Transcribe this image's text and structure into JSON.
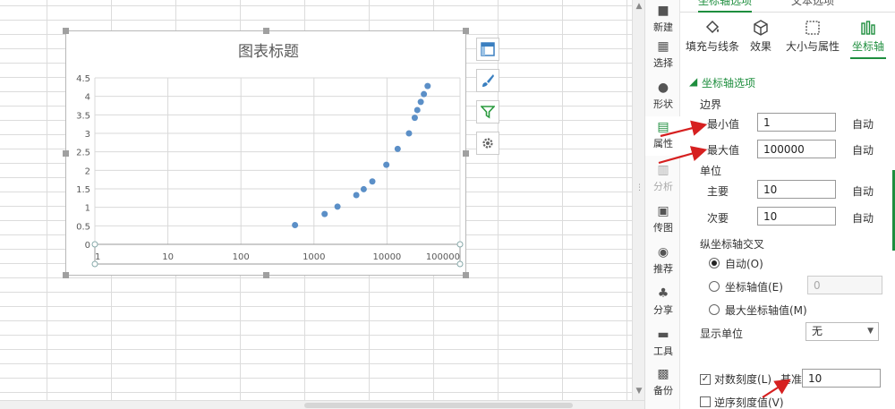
{
  "chart_data": {
    "type": "scatter",
    "title": "图表标题",
    "x_scale": "log",
    "xlim": [
      1,
      100000
    ],
    "ylim": [
      0,
      4.5
    ],
    "x_ticks": [
      "1",
      "10",
      "100",
      "1000",
      "10000",
      "100000"
    ],
    "y_ticks": [
      "0",
      "0.5",
      "1",
      "1.5",
      "2",
      "2.5",
      "3",
      "3.5",
      "4",
      "4.5"
    ],
    "grid": true,
    "color": "#5b8fc7",
    "series": [
      {
        "x": [
          550,
          1400,
          2100,
          3800,
          4800,
          6300,
          9800,
          14000,
          20000,
          24000,
          26000,
          29000,
          32000,
          36000
        ],
        "y": [
          0.52,
          0.82,
          1.02,
          1.33,
          1.49,
          1.7,
          2.15,
          2.58,
          3.0,
          3.42,
          3.63,
          3.85,
          4.06,
          4.28
        ]
      }
    ]
  },
  "side_nav": [
    {
      "label": "新建",
      "icon": "new-icon"
    },
    {
      "label": "选择",
      "icon": "select-icon"
    },
    {
      "label": "形状",
      "icon": "shape-icon"
    },
    {
      "label": "属性",
      "icon": "property-icon"
    },
    {
      "label": "分析",
      "icon": "analysis-icon"
    },
    {
      "label": "传图",
      "icon": "upload-image-icon"
    },
    {
      "label": "推荐",
      "icon": "recommend-icon"
    },
    {
      "label": "分享",
      "icon": "share-icon"
    },
    {
      "label": "工具",
      "icon": "toolbox-icon"
    },
    {
      "label": "备份",
      "icon": "backup-icon"
    }
  ],
  "pane": {
    "tabs": [
      "坐标轴选项",
      "文本选项"
    ],
    "sub_tabs": [
      "填充与线条",
      "效果",
      "大小与属性",
      "坐标轴"
    ],
    "section_title": "坐标轴选项",
    "bounds_label": "边界",
    "min_label": "最小值",
    "min_value": "1",
    "max_label": "最大值",
    "max_value": "100000",
    "auto_label": "自动",
    "units_label": "单位",
    "major_label": "主要",
    "major_value": "10",
    "minor_label": "次要",
    "minor_value": "10",
    "cross_label": "纵坐标轴交叉",
    "cross_auto": "自动(O)",
    "cross_axis_value": "坐标轴值(E)",
    "cross_axis_value_input": "0",
    "cross_max": "最大坐标轴值(M)",
    "display_unit_label": "显示单位",
    "display_unit_value": "无",
    "log_scale_label": "对数刻度(L)",
    "log_base_label": "基准",
    "log_base_value": "10",
    "reverse_label": "逆序刻度值(V)"
  },
  "colors": {
    "accent": "#1e8e3e",
    "marker": "#5b8fc7",
    "annotation_arrow": "#d62020"
  }
}
